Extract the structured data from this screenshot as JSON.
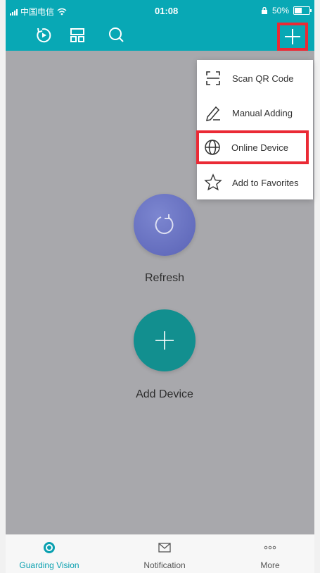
{
  "status_bar": {
    "carrier": "中国电信",
    "time": "01:08",
    "battery": "50%",
    "battery_level": 0.5
  },
  "header": {
    "icons": [
      "playback-icon",
      "layout-icon",
      "search-icon",
      "add-icon"
    ]
  },
  "menu": {
    "items": [
      {
        "label": "Scan QR Code",
        "icon": "scan-qr-icon"
      },
      {
        "label": "Manual Adding",
        "icon": "pencil-icon"
      },
      {
        "label": "Online Device",
        "icon": "globe-icon",
        "highlighted": true
      },
      {
        "label": "Add to Favorites",
        "icon": "star-icon"
      }
    ]
  },
  "main": {
    "refresh_label": "Refresh",
    "add_device_label": "Add Device"
  },
  "tabs": [
    {
      "label": "Guarding Vision",
      "icon": "target-icon",
      "active": true
    },
    {
      "label": "Notification",
      "icon": "mail-icon",
      "active": false
    },
    {
      "label": "More",
      "icon": "more-icon",
      "active": false
    }
  ],
  "colors": {
    "accent": "#08a8b5",
    "highlight": "#ea2a35",
    "overlay": "#a8a8ac"
  }
}
